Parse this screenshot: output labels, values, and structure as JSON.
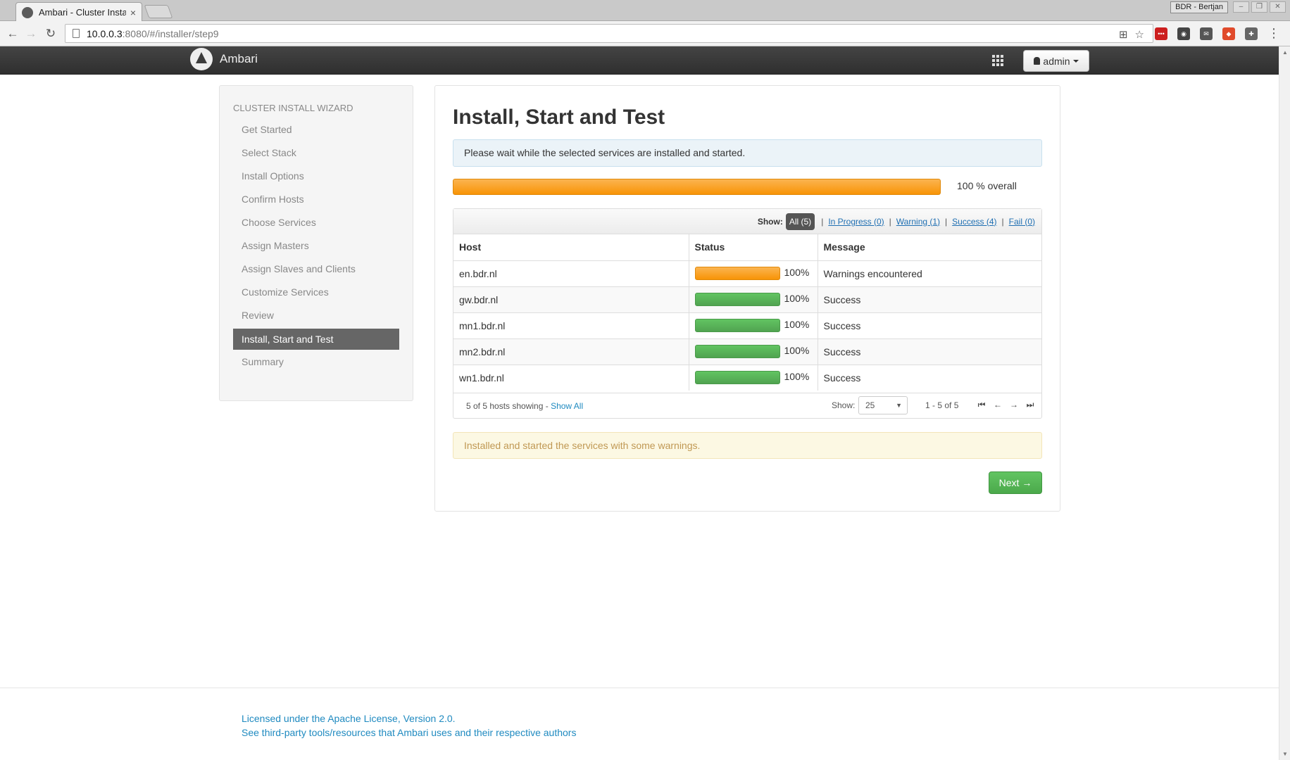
{
  "browser": {
    "tab_title": "Ambari - Cluster Instal",
    "tab_close": "×",
    "profile": "BDR - Bertjan",
    "url_host": "10.0.0.3",
    "url_path": ":8080/#/installer/step9"
  },
  "app": {
    "brand": "Ambari",
    "user_menu": "admin"
  },
  "sidebar": {
    "title": "CLUSTER INSTALL WIZARD",
    "items": [
      {
        "label": "Get Started"
      },
      {
        "label": "Select Stack"
      },
      {
        "label": "Install Options"
      },
      {
        "label": "Confirm Hosts"
      },
      {
        "label": "Choose Services"
      },
      {
        "label": "Assign Masters"
      },
      {
        "label": "Assign Slaves and Clients"
      },
      {
        "label": "Customize Services"
      },
      {
        "label": "Review"
      },
      {
        "label": "Install, Start and Test"
      },
      {
        "label": "Summary"
      }
    ],
    "active_index": 9
  },
  "main": {
    "title": "Install, Start and Test",
    "info_text": "Please wait while the selected services are installed and started.",
    "overall_progress": 1.0,
    "overall_label": "100 % overall",
    "filter": {
      "show_label": "Show:",
      "all": "All (5)",
      "in_progress": "In Progress (0)",
      "warning": "Warning (1)",
      "success": "Success (4)",
      "fail": "Fail (0)"
    },
    "columns": {
      "host": "Host",
      "status": "Status",
      "message": "Message"
    },
    "rows": [
      {
        "host": "en.bdr.nl",
        "progress": 1.0,
        "percent": "100%",
        "message": "Warnings encountered",
        "state": "warning",
        "bar_color": "#f89406"
      },
      {
        "host": "gw.bdr.nl",
        "progress": 1.0,
        "percent": "100%",
        "message": "Success",
        "state": "success",
        "bar_color": "#51a351"
      },
      {
        "host": "mn1.bdr.nl",
        "progress": 1.0,
        "percent": "100%",
        "message": "Success",
        "state": "success",
        "bar_color": "#51a351"
      },
      {
        "host": "mn2.bdr.nl",
        "progress": 1.0,
        "percent": "100%",
        "message": "Success",
        "state": "success",
        "bar_color": "#51a351"
      },
      {
        "host": "wn1.bdr.nl",
        "progress": 1.0,
        "percent": "100%",
        "message": "Success",
        "state": "success",
        "bar_color": "#51a351"
      }
    ],
    "table_footer": {
      "count_text": "5 of 5 hosts showing - ",
      "show_all": "Show All",
      "page_show_label": "Show:",
      "page_size": "25",
      "range": "1 - 5 of 5"
    },
    "warning_text": "Installed and started the services with some warnings.",
    "next_button": "Next →"
  },
  "footer": {
    "license": "Licensed under the Apache License, Version 2.0.",
    "third_party": "See third-party tools/resources that Ambari uses and their respective authors"
  },
  "colors": {
    "nav_bg": "#3c3c3c",
    "warning": "#f89406",
    "success": "#51a351",
    "link": "#1f8ac0"
  }
}
